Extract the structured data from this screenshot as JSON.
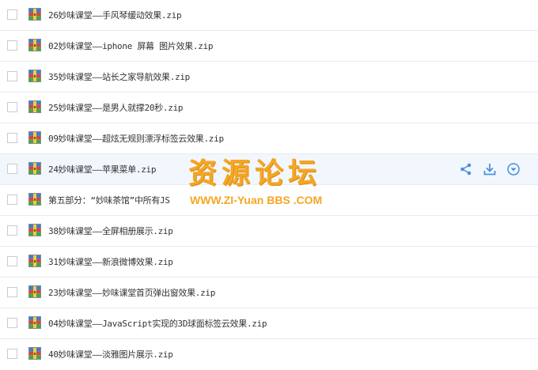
{
  "files": [
    {
      "name": "26妙味课堂——手风琴缓动效果.zip"
    },
    {
      "name": "02妙味课堂——iphone 屏幕 图片效果.zip"
    },
    {
      "name": "35妙味课堂——站长之家导航效果.zip"
    },
    {
      "name": "25妙味课堂——是男人就撑20秒.zip"
    },
    {
      "name": "09妙味课堂——超炫无规则漂浮标签云效果.zip"
    },
    {
      "name": "24妙味课堂——苹果菜单.zip"
    },
    {
      "name": "第五部分：“妙味茶馆”中所有JS"
    },
    {
      "name": "38妙味课堂——全屏相册展示.zip"
    },
    {
      "name": "31妙味课堂——新浪微博效果.zip"
    },
    {
      "name": "23妙味课堂——妙味课堂首页弹出窗效果.zip"
    },
    {
      "name": "04妙味课堂——JavaScript实现的3D球面标签云效果.zip"
    },
    {
      "name": "40妙味课堂——淡雅图片展示.zip"
    }
  ],
  "hover_row": 5,
  "row_actions": [
    "share-icon",
    "download-icon",
    "more-icon"
  ],
  "file_icon": "zip-archive-icon",
  "watermark": {
    "title": "资源论坛",
    "url": "WWW.ZI-Yuan BBS .COM"
  },
  "colors": {
    "accent": "#4a90e2",
    "watermark": "#f5a623",
    "hover_bg": "#f2f7fd"
  }
}
